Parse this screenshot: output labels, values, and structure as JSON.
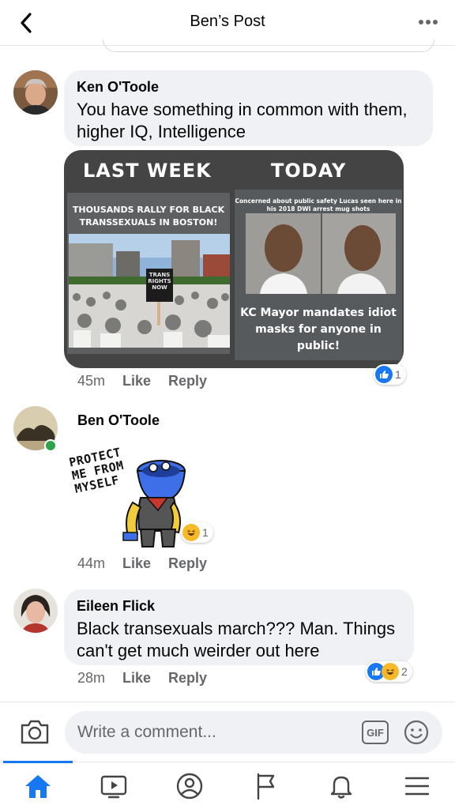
{
  "header": {
    "title": "Ben’s Post"
  },
  "comments": [
    {
      "author": "Ken O'Toole",
      "text": "You have something in common with them, higher IQ, Intelligence",
      "time": "45m",
      "like_label": "Like",
      "reply_label": "Reply",
      "reactions": {
        "types": [
          "like"
        ],
        "count": "1"
      },
      "meme": {
        "left_title": "LAST WEEK",
        "right_title": "TODAY",
        "left_caption": "THOUSANDS RALLY FOR BLACK TRANSSEXUALS IN BOSTON!",
        "sign_text": "TRANS RIGHTS NOW",
        "right_caption": "Concerned about public safety Lucas seen here in his 2018 DWI arrest mug shots",
        "right_bottom": "KC Mayor mandates idiot masks for anyone in public!"
      }
    },
    {
      "author": "Ben O'Toole",
      "sticker_text": "PROTECT ME FROM MYSELF",
      "time": "44m",
      "like_label": "Like",
      "reply_label": "Reply",
      "reactions": {
        "types": [
          "haha"
        ],
        "count": "1"
      },
      "online": true
    },
    {
      "author": "Eileen Flick",
      "text": "Black transexuals march??? Man. Things can't get much weirder out here",
      "time": "28m",
      "like_label": "Like",
      "reply_label": "Reply",
      "reactions": {
        "types": [
          "like",
          "haha"
        ],
        "count": "2"
      }
    }
  ],
  "composer": {
    "placeholder": "Write a comment...",
    "gif_label": "GIF"
  },
  "bottom_nav": {
    "items": [
      "home-icon",
      "watch-icon",
      "profile-icon",
      "pages-flag-icon",
      "notifications-bell-icon",
      "menu-icon"
    ],
    "active": "home-icon"
  },
  "colors": {
    "accent": "#1877f2",
    "bubble": "#eff1f4",
    "secondary_text": "#65676b",
    "online": "#31a24c",
    "haha": "#f7b928"
  }
}
